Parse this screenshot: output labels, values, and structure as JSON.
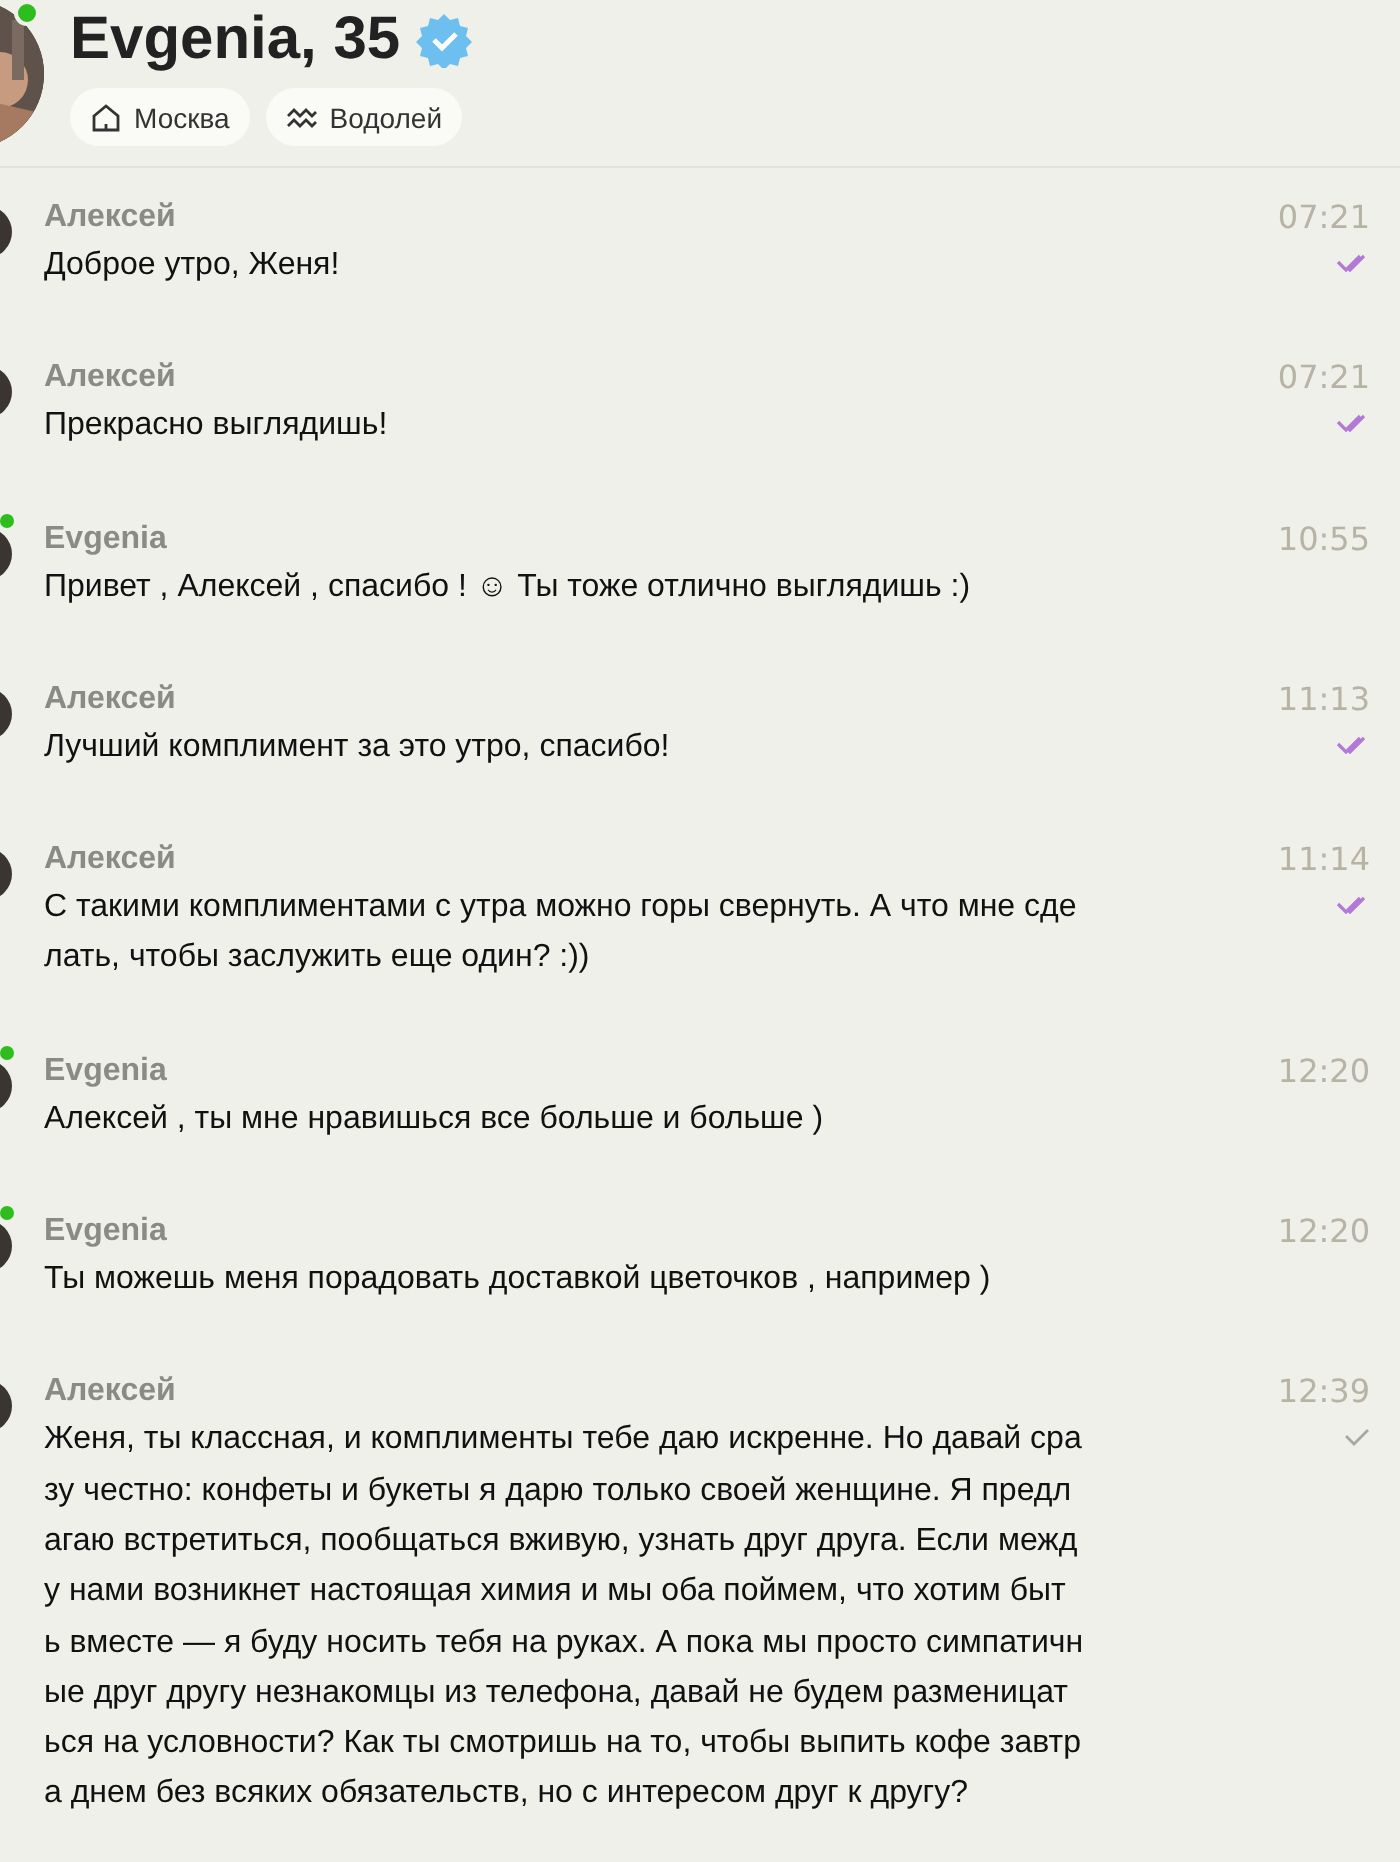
{
  "profile": {
    "name": "Evgenia, 35",
    "verified": true,
    "online": true,
    "tags": [
      {
        "kind": "city",
        "label": "Москва"
      },
      {
        "kind": "zodiac",
        "label": "Водолей"
      }
    ]
  },
  "messages": [
    {
      "sender": "Алексей",
      "text": "Доброе утро, Женя!",
      "time": "07:21",
      "sent": true,
      "read": true,
      "online": false
    },
    {
      "sender": "Алексей",
      "text": "Прекрасно выглядишь!",
      "time": "07:21",
      "sent": true,
      "read": true,
      "online": false
    },
    {
      "sender": "Evgenia",
      "text": "Привет , Алексей , спасибо ! ☺ Ты тоже отлично выглядишь :)",
      "time": "10:55",
      "sent": false,
      "read": false,
      "online": true
    },
    {
      "sender": "Алексей",
      "text": "Лучший комплимент за это утро, спасибо!",
      "time": "11:13",
      "sent": true,
      "read": true,
      "online": false
    },
    {
      "sender": "Алексей",
      "text": "С такими комплиментами с утра можно горы свернуть. А что мне сде\nлать, чтобы заслужить еще один? :))",
      "time": "11:14",
      "sent": true,
      "read": true,
      "online": false
    },
    {
      "sender": "Evgenia",
      "text": "Алексей , ты мне нравишься все больше и больше )",
      "time": "12:20",
      "sent": false,
      "read": false,
      "online": true
    },
    {
      "sender": "Evgenia",
      "text": "Ты можешь меня порадовать доставкой цветочков , например )",
      "time": "12:20",
      "sent": false,
      "read": false,
      "online": true
    },
    {
      "sender": "Алексей",
      "text": "Женя, ты классная, и комплименты тебе даю искренне. Но давай сра\nзу честно: конфеты и букеты я дарю только своей женщине. Я предл\nагаю встретиться, пообщаться вживую, узнать друг друга. Если межд\nу нами возникнет настоящая химия и мы оба поймем, что хотим быт\nь вместе — я буду носить тебя на руках. А пока мы просто симпатичн\nые друг другу незнакомцы из телефона, давай не будем разменицат\nься на условности? Как ты смотришь на то, чтобы выпить кофе завтр\nа днем без всяких обязательств, но с интересом друг к другу?",
      "time": "12:39",
      "sent": true,
      "read": false,
      "online": false
    }
  ]
}
